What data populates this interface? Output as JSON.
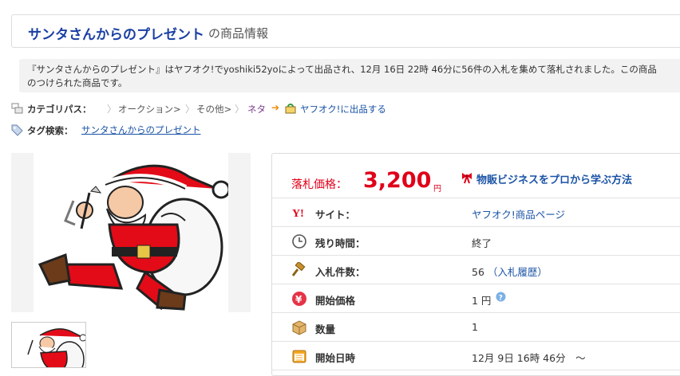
{
  "header": {
    "title": "サンタさんからのプレゼント",
    "suffix": "の商品情報"
  },
  "description": {
    "line1": "『サンタさんからのプレゼント』はヤフオク!でyoshiki52yoによって出品され、12月 16日 22時 46分に56件の入札を集めて落札されました。この商品",
    "line2": "のつけられた商品です。"
  },
  "breadcrumb": {
    "label": "カテゴリパス：",
    "items": [
      "オークション>",
      "その他>",
      "ネタ"
    ],
    "sell_link": "ヤフオク!に出品する"
  },
  "tags": {
    "label": "タグ検索：",
    "link": "サンタさんからのプレゼント"
  },
  "price": {
    "label": "落札価格：",
    "value": "3,200",
    "unit": "円",
    "promo": "物販ビジネスをプロから学ぶ方法"
  },
  "rows": [
    {
      "label": "サイト：",
      "value": "ヤフオク!商品ページ",
      "icon": "yahoo-icon"
    },
    {
      "label": "残り時間：",
      "value": "終了",
      "icon": "clock-icon"
    },
    {
      "label": "入札件数：",
      "value": "56",
      "link": "（入札履歴）",
      "icon": "gavel-icon"
    },
    {
      "label": "開始価格",
      "value": "1 円",
      "icon": "yen-icon"
    },
    {
      "label": "数量",
      "value": "1",
      "icon": "box-icon"
    },
    {
      "label": "開始日時",
      "value": "12月 9日 16時 46分　～",
      "icon": "calendar-icon"
    }
  ],
  "colors": {
    "accent": "#1a3fa3",
    "price": "#e0001a",
    "link": "#1a53a6"
  }
}
